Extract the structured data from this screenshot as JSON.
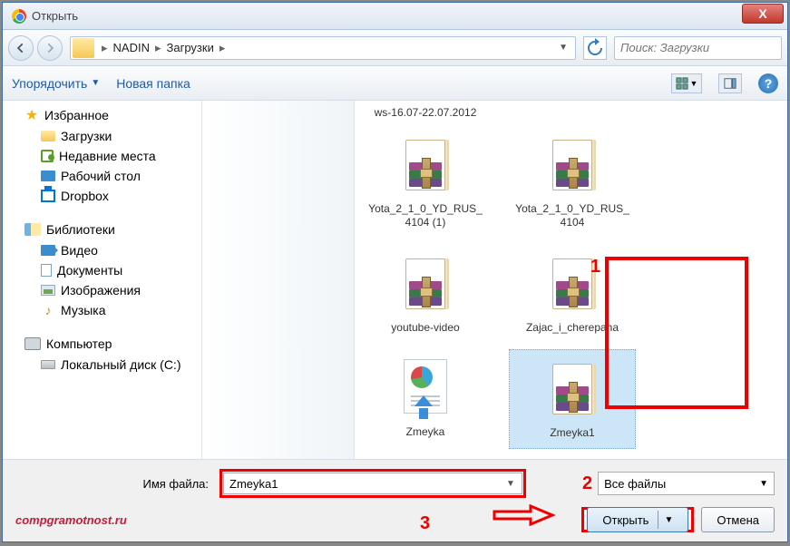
{
  "window": {
    "title": "Открыть"
  },
  "breadcrumb": {
    "parts": [
      "NADIN",
      "Загрузки"
    ],
    "sep": "▸"
  },
  "search": {
    "placeholder": "Поиск: Загрузки"
  },
  "toolbar": {
    "organize": "Упорядочить",
    "newfolder": "Новая папка"
  },
  "sidebar": {
    "favorites": {
      "head": "Избранное",
      "items": [
        "Загрузки",
        "Недавние места",
        "Рабочий стол",
        "Dropbox"
      ]
    },
    "libraries": {
      "head": "Библиотеки",
      "items": [
        "Видео",
        "Документы",
        "Изображения",
        "Музыка"
      ]
    },
    "computer": {
      "head": "Компьютер",
      "items": [
        "Локальный диск (C:)"
      ]
    }
  },
  "files": {
    "truncated": "ws-16.07-22.07.2012",
    "items": [
      {
        "name": "Yota_2_1_0_YD_RUS_4104 (1)",
        "type": "rar"
      },
      {
        "name": "Yota_2_1_0_YD_RUS_4104",
        "type": "rar"
      },
      {
        "name": "youtube-video",
        "type": "rar"
      },
      {
        "name": "Zajac_i_cherepaha",
        "type": "rar"
      },
      {
        "name": "Zmeyka",
        "type": "ppt"
      },
      {
        "name": "Zmeyka1",
        "type": "rar",
        "selected": true
      }
    ]
  },
  "footer": {
    "filename_label": "Имя файла:",
    "filename_value": "Zmeyka1",
    "filter": "Все файлы",
    "open": "Открыть",
    "cancel": "Отмена",
    "watermark": "compgramotnost.ru"
  },
  "annotations": {
    "n1": "1",
    "n2": "2",
    "n3": "3"
  }
}
